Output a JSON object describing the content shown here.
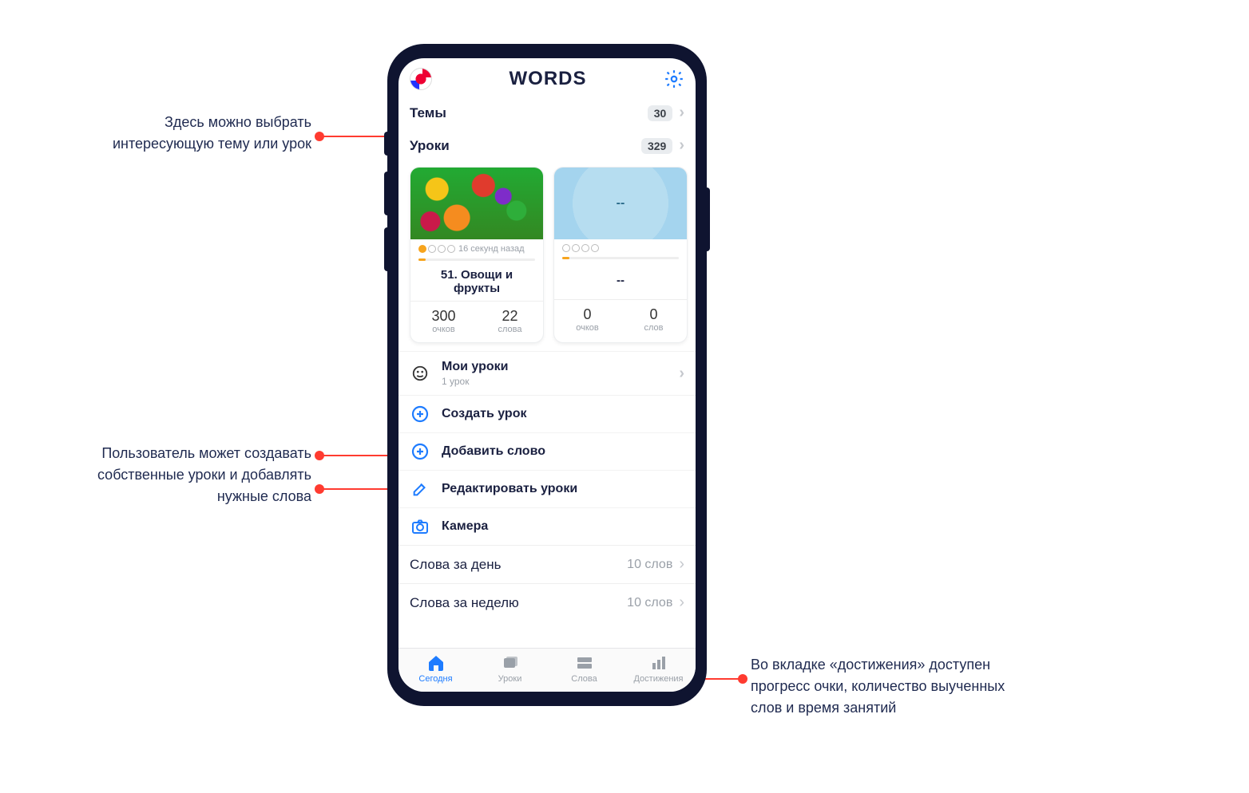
{
  "annotations": {
    "a1": "Здесь можно выбрать интересующую тему или урок",
    "a2": "Пользователь может создавать собственные уроки и добавлять нужные слова",
    "a3": "Во вкладке «достижения» доступен прогресс очки, количество выученных слов и время занятий"
  },
  "header": {
    "app_title": "WORDS",
    "flag_name": "uk-flag-icon",
    "settings_icon": "gear-icon"
  },
  "rows": {
    "themes": {
      "label": "Темы",
      "count": "30"
    },
    "lessons": {
      "label": "Уроки",
      "count": "329"
    }
  },
  "cards": [
    {
      "meta_time": "16 секунд назад",
      "title": "51. Овощи и фрукты",
      "stats": [
        {
          "val": "300",
          "lbl": "очков"
        },
        {
          "val": "22",
          "lbl": "слова"
        }
      ],
      "dots_on": 1,
      "img": "fruits"
    },
    {
      "meta_time": "",
      "title": "--",
      "img_text": "--",
      "stats": [
        {
          "val": "0",
          "lbl": "очков"
        },
        {
          "val": "0",
          "lbl": "слов"
        }
      ],
      "dots_on": 0,
      "img": "placeholder"
    }
  ],
  "menu": {
    "my_lessons": {
      "label": "Мои уроки",
      "sub": "1 урок"
    },
    "create": "Создать урок",
    "add_word": "Добавить слово",
    "edit": "Редактировать уроки",
    "camera": "Камера"
  },
  "stats_rows": [
    {
      "label": "Слова за день",
      "value": "10 слов"
    },
    {
      "label": "Слова за неделю",
      "value": "10 слов"
    }
  ],
  "tabs": {
    "today": "Сегодня",
    "lessons": "Уроки",
    "words": "Слова",
    "ach": "Достижения"
  }
}
